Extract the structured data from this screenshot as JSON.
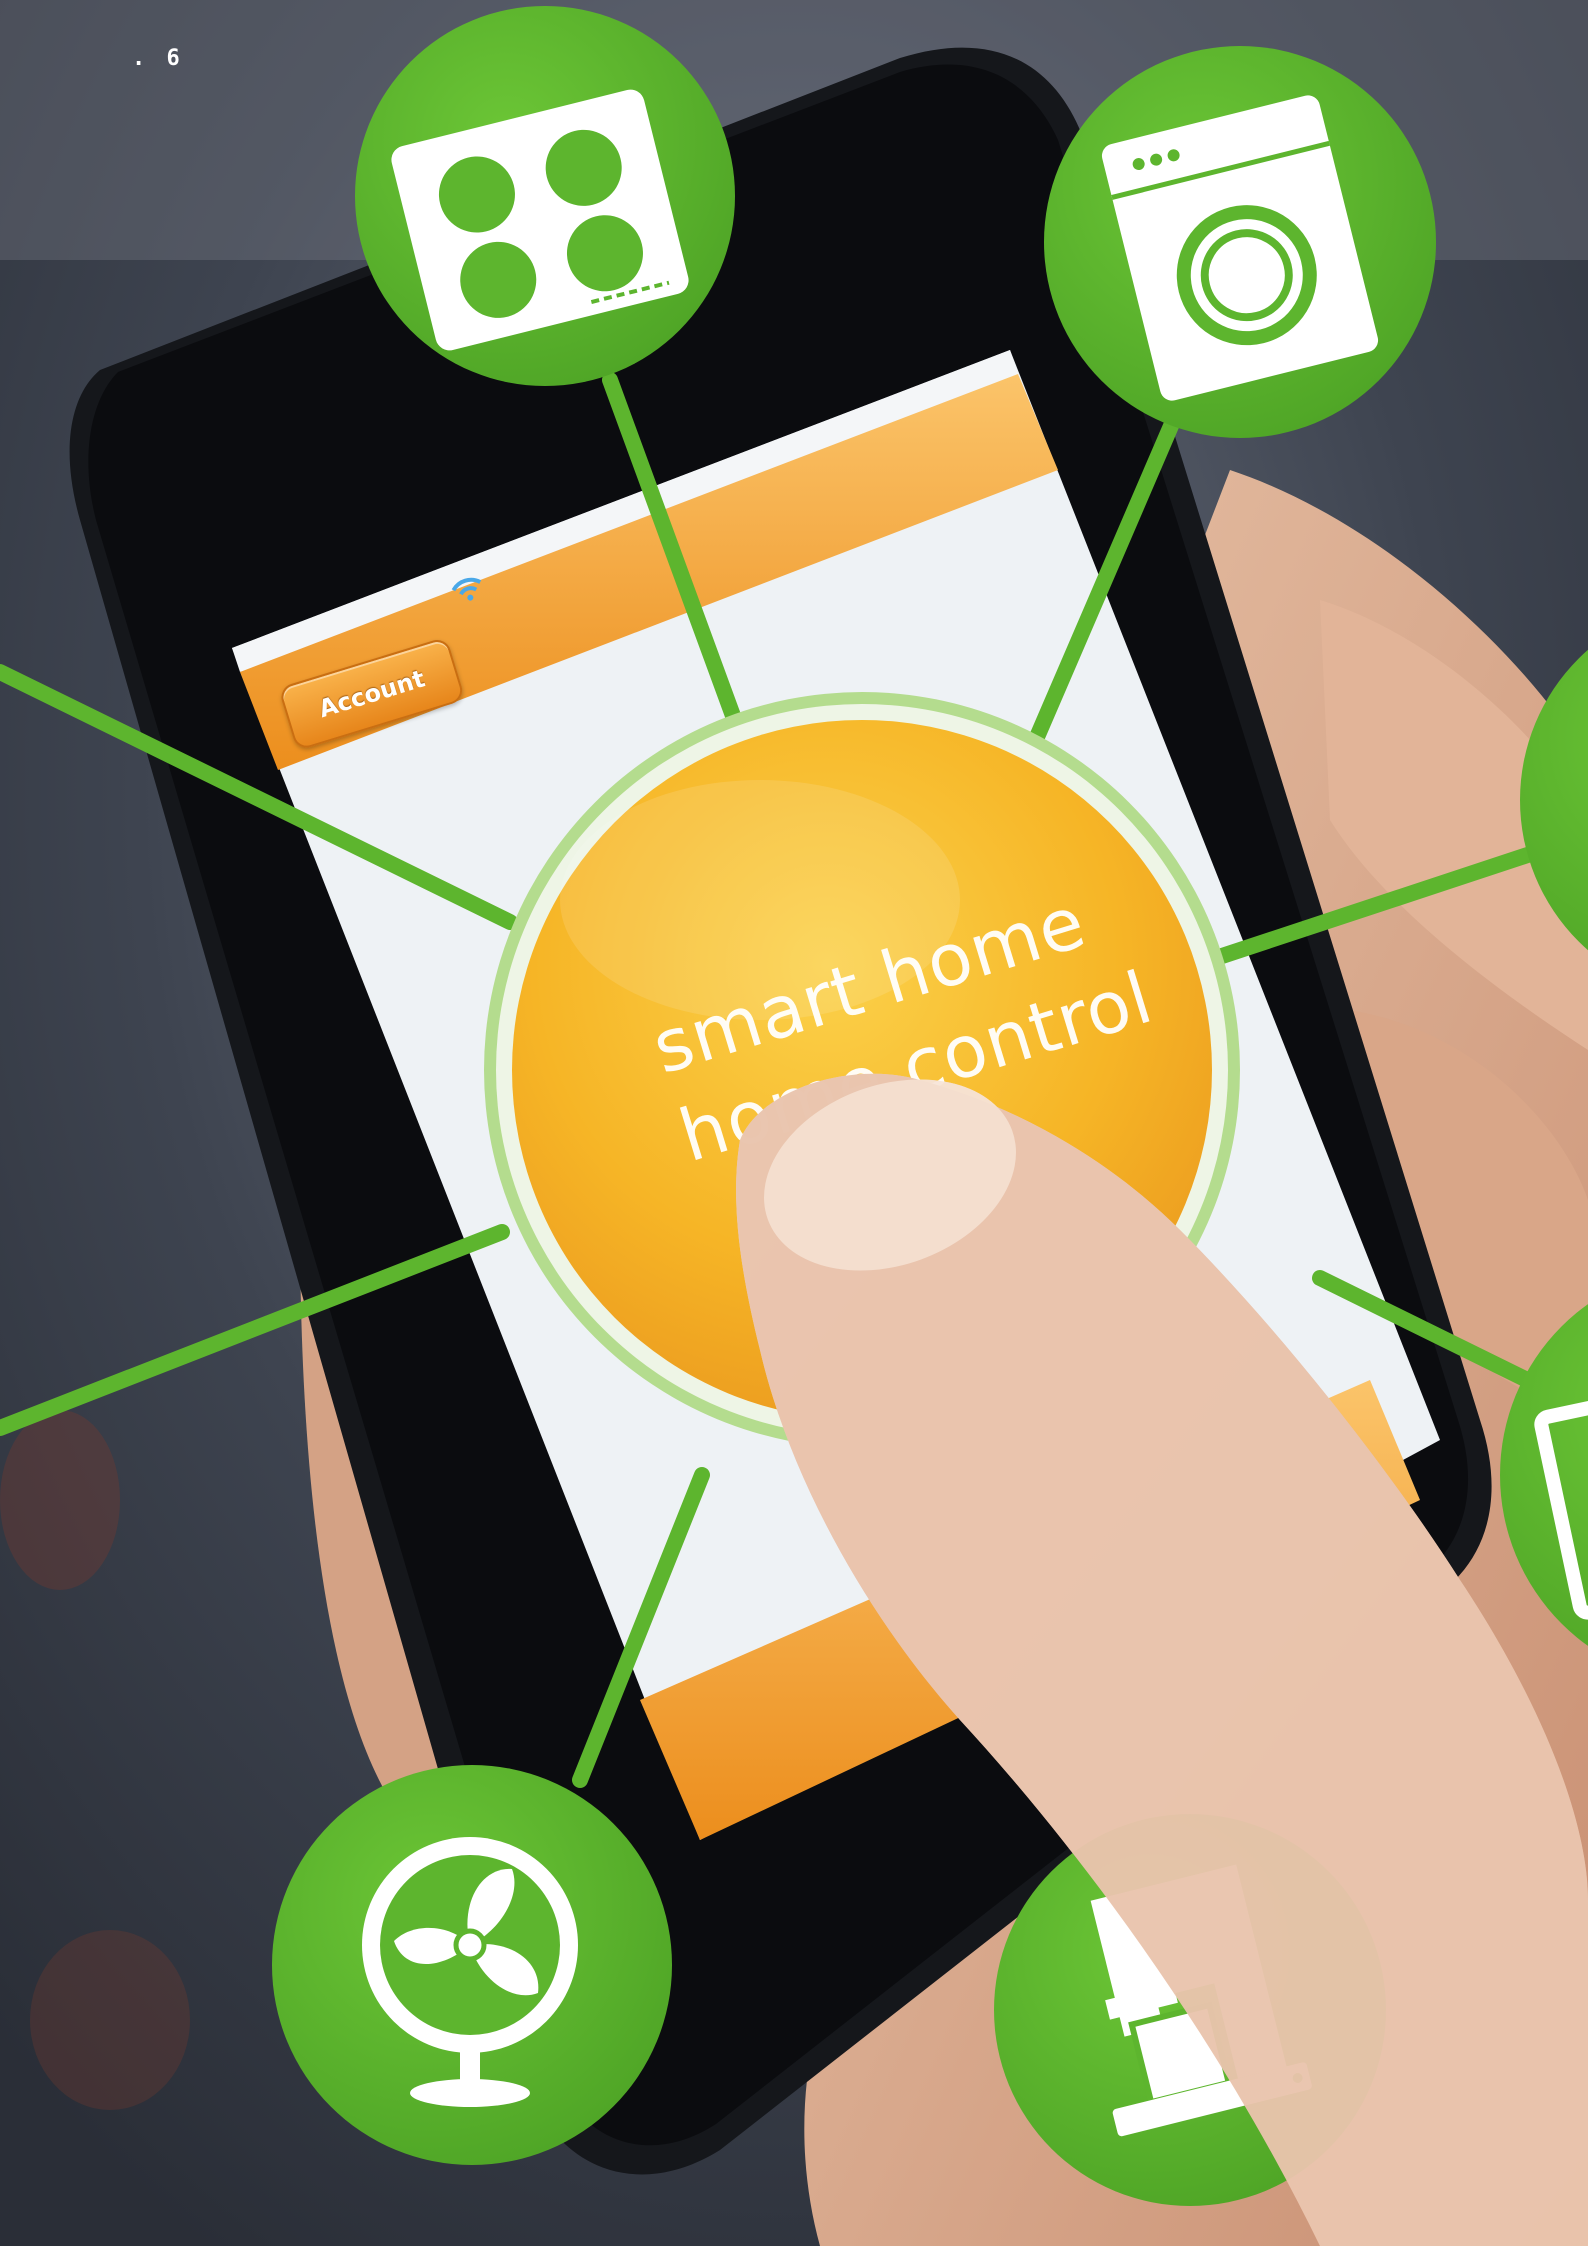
{
  "page_number": ". 6",
  "phone": {
    "header": {
      "account_label": "Account",
      "wifi": "wifi-icon"
    },
    "center_title": "smart home\nhome control"
  },
  "colors": {
    "accent_green": "#5db52e",
    "orange": "#f3a22b",
    "yellow": "#f8c21d",
    "screen_white": "#f1f4f6"
  },
  "appliance_icons": [
    "cooktop-icon",
    "washing-machine-icon",
    "fan-icon",
    "coffee-maker-icon"
  ]
}
